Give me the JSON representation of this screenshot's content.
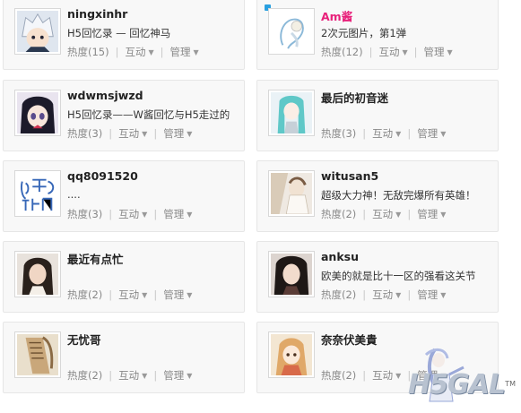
{
  "cards": [
    {
      "name": "ningxinhr",
      "desc": "H5回忆录 — 回忆神马",
      "heat": "热度(15)",
      "interact": "互动",
      "manage": "管理",
      "pink": false,
      "badge": false,
      "avatar": "avatar-silver-hair"
    },
    {
      "name": "Am酱",
      "desc": "2次元图片，第1弹",
      "heat": "热度(12)",
      "interact": "互动",
      "manage": "管理",
      "pink": true,
      "badge": true,
      "avatar": "avatar-white-girl"
    },
    {
      "name": "wdwmsjwzd",
      "desc": "H5回忆录——W酱回忆与H5走过的",
      "heat": "热度(3)",
      "interact": "互动",
      "manage": "管理",
      "pink": false,
      "badge": false,
      "avatar": "avatar-anime-girl"
    },
    {
      "name": "最后的初音迷",
      "desc": "",
      "heat": "热度(3)",
      "interact": "互动",
      "manage": "管理",
      "pink": false,
      "badge": false,
      "avatar": "avatar-miku"
    },
    {
      "name": "qq8091520",
      "desc": "....",
      "heat": "热度(3)",
      "interact": "互动",
      "manage": "管理",
      "pink": false,
      "badge": false,
      "avatar": "avatar-text-logo"
    },
    {
      "name": "witusan5",
      "desc": "超级大力神！无敌完爆所有英雄！",
      "heat": "热度(2)",
      "interact": "互动",
      "manage": "管理",
      "pink": false,
      "badge": false,
      "avatar": "avatar-doll"
    },
    {
      "name": "最近有点忙",
      "desc": "",
      "heat": "热度(2)",
      "interact": "互动",
      "manage": "管理",
      "pink": false,
      "badge": false,
      "avatar": "avatar-girl-photo"
    },
    {
      "name": "anksu",
      "desc": "欧美的就是比十一区的强看这关节",
      "heat": "热度(2)",
      "interact": "互动",
      "manage": "管理",
      "pink": false,
      "badge": false,
      "avatar": "avatar-girl-dark-hair"
    },
    {
      "name": "无忧哥",
      "desc": "",
      "heat": "热度(2)",
      "interact": "互动",
      "manage": "管理",
      "pink": false,
      "badge": false,
      "avatar": "avatar-scroll"
    },
    {
      "name": "奈奈伏美貴",
      "desc": "",
      "heat": "热度(2)",
      "interact": "互动",
      "manage": "管理",
      "pink": false,
      "badge": false,
      "avatar": "avatar-anime-warm"
    }
  ],
  "watermark": {
    "text": "H5GAL",
    "tm": "TM"
  }
}
